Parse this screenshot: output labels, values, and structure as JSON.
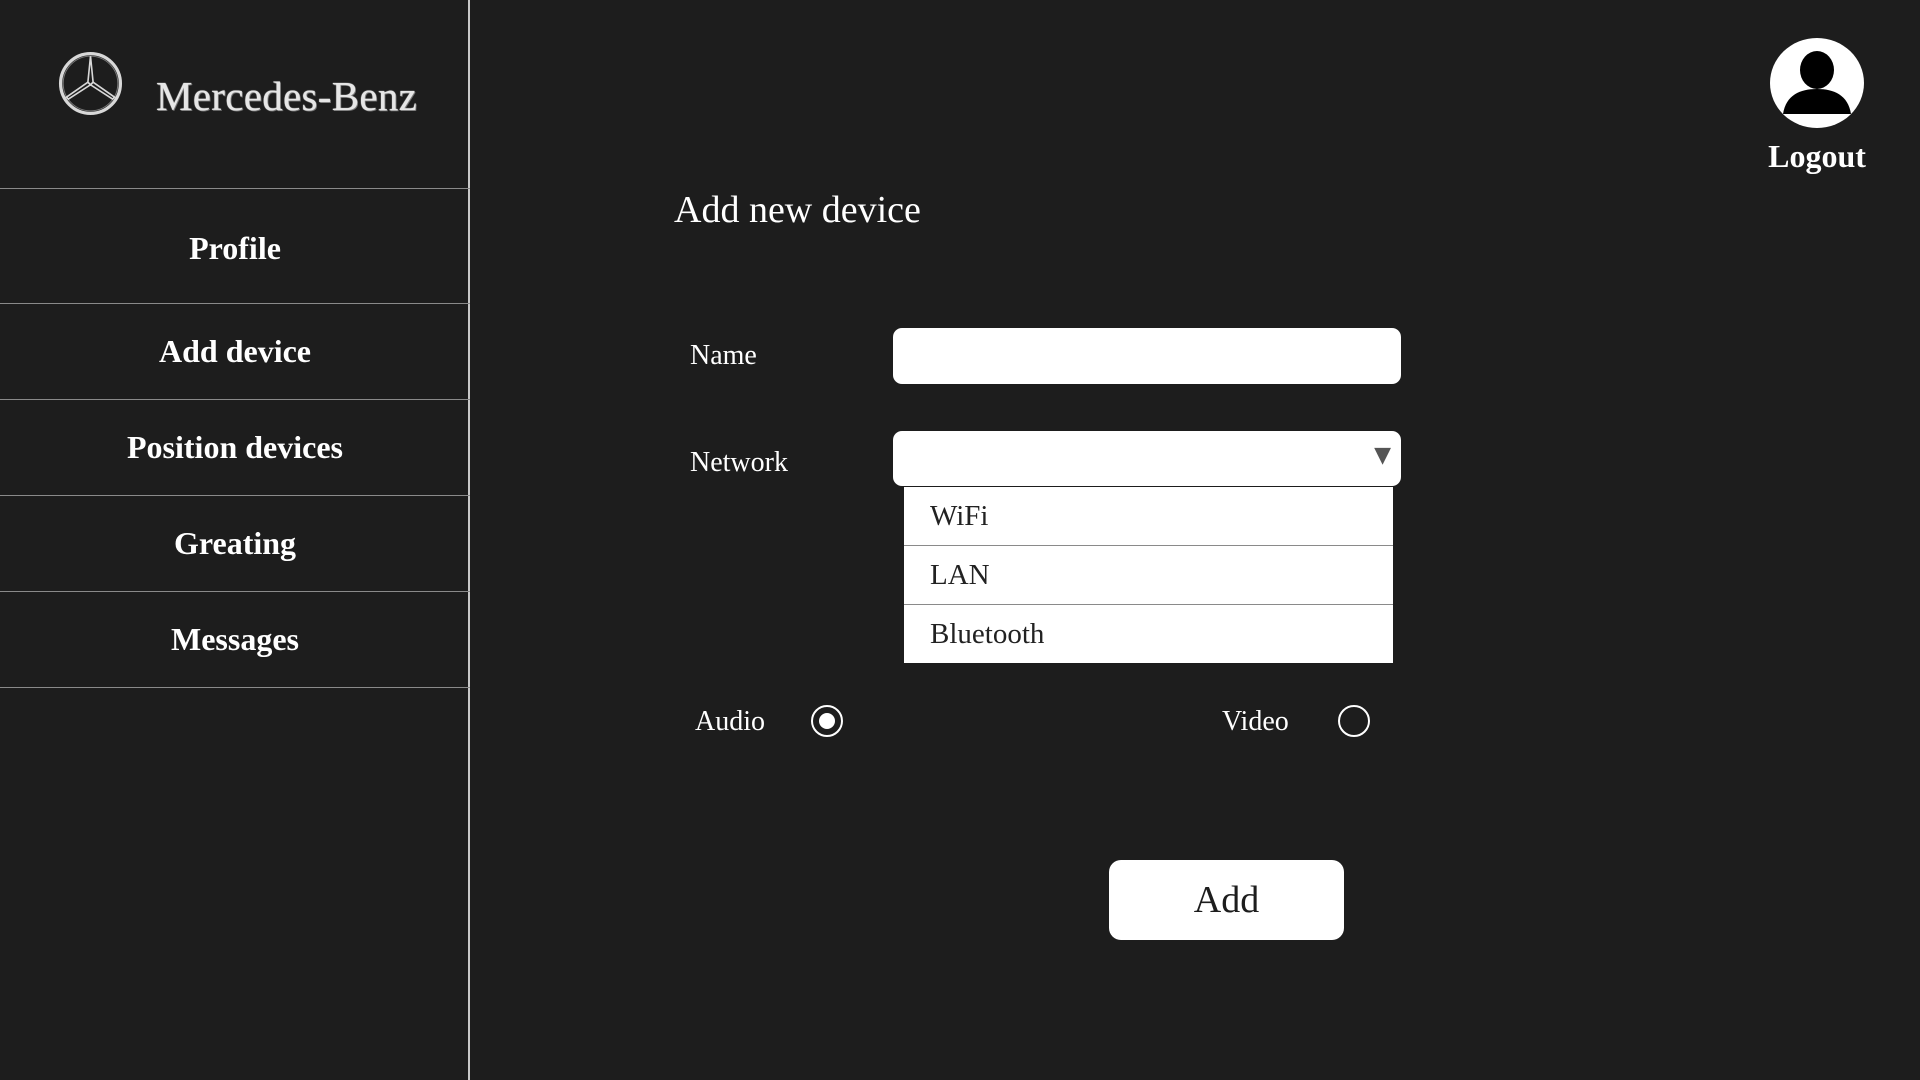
{
  "brand": {
    "logo_icon": "mercedes-star-icon",
    "name": "Mercedes-Benz"
  },
  "sidebar": {
    "items": [
      {
        "label": "Profile"
      },
      {
        "label": "Add device"
      },
      {
        "label": "Position devices"
      },
      {
        "label": "Greating"
      },
      {
        "label": "Messages"
      }
    ]
  },
  "user": {
    "avatar_icon": "user-avatar-icon",
    "logout_label": "Logout"
  },
  "form": {
    "title": "Add new device",
    "name_label": "Name",
    "name_value": "",
    "network_label": "Network",
    "network_value": "",
    "network_options": [
      "WiFi",
      "LAN",
      "Bluetooth"
    ],
    "audio_label": "Audio",
    "audio_selected": true,
    "video_label": "Video",
    "video_selected": false,
    "submit_label": "Add"
  },
  "colors": {
    "background": "#1d1d1d",
    "foreground": "#ffffff",
    "divider": "#8a8a8a"
  }
}
